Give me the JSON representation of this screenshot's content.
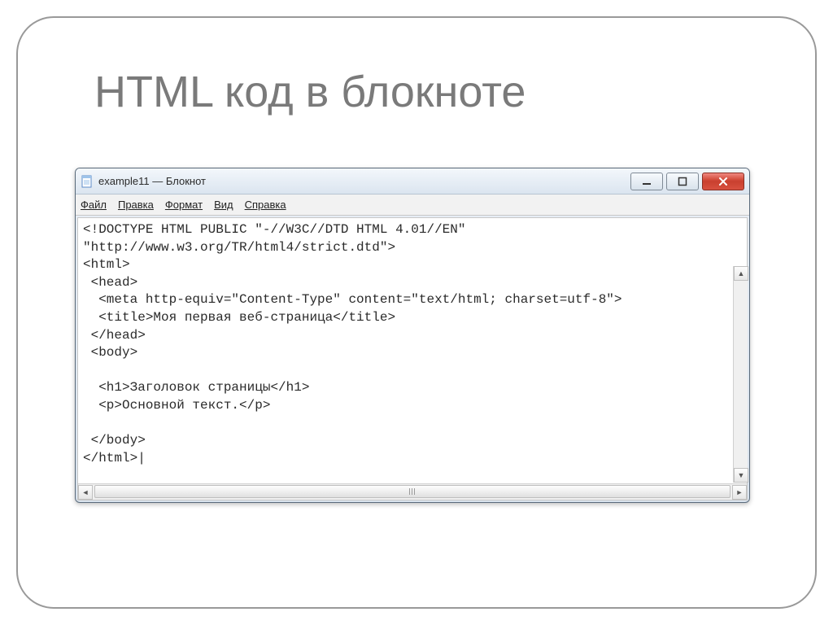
{
  "slide": {
    "title": "HTML код  в блокноте"
  },
  "window": {
    "title": "example11 — Блокнот",
    "menu": {
      "file": "Файл",
      "edit": "Правка",
      "format": "Формат",
      "view": "Вид",
      "help": "Справка"
    },
    "content": "<!DOCTYPE HTML PUBLIC \"-//W3C//DTD HTML 4.01//EN\"\n\"http://www.w3.org/TR/html4/strict.dtd\">\n<html>\n <head>\n  <meta http-equiv=\"Content-Type\" content=\"text/html; charset=utf-8\">\n  <title>Моя первая веб-страница</title>\n </head>\n <body>\n\n  <h1>Заголовок страницы</h1>\n  <p>Основной текст.</p>\n\n </body>\n</html>|"
  }
}
